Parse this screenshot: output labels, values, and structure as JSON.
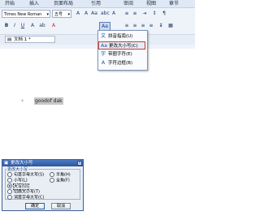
{
  "menubar": {
    "items": [
      "开始",
      "插入",
      "页面布局",
      "引用",
      "审阅",
      "视图",
      "章节"
    ]
  },
  "toolbar": {
    "font_name": "Times New Roman",
    "font_size": "五号",
    "row1_icons": [
      "A",
      "A",
      "Aa",
      "abc",
      "A"
    ],
    "row2_icons": [
      "B",
      "I",
      "U",
      "A",
      "ab",
      "A"
    ],
    "change_case_icon": "Aa"
  },
  "tabs": {
    "doc_tab": "文档 1 *"
  },
  "dropdown": {
    "items": [
      {
        "label": "拼音指南(U)",
        "icon": "pinyin-icon",
        "glyph": "文"
      },
      {
        "label": "更改大小写(C)",
        "icon": "change-case-icon",
        "glyph": "Aa"
      },
      {
        "label": "带圈字符(E)",
        "icon": "circled-char-icon",
        "glyph": "字"
      },
      {
        "label": "字符边框(B)",
        "icon": "char-border-icon",
        "glyph": "A"
      }
    ]
  },
  "document": {
    "selected_text": "goodof dak",
    "para_mark": "+"
  },
  "dialog": {
    "title": "更改大小写",
    "close_label": "×",
    "group_label": "更改大小写",
    "options": [
      {
        "label": "句首字母大写(S)",
        "checked": false
      },
      {
        "label": "小写(L)",
        "checked": false
      },
      {
        "label": "大写(U)",
        "checked": true
      },
      {
        "label": "切换大小写(T)",
        "checked": false
      },
      {
        "label": "词首字母大写(C)",
        "checked": false
      },
      {
        "label": "半角(H)",
        "checked": false
      },
      {
        "label": "全角(F)",
        "checked": false
      }
    ],
    "ok_label": "确定",
    "cancel_label": "取消"
  }
}
